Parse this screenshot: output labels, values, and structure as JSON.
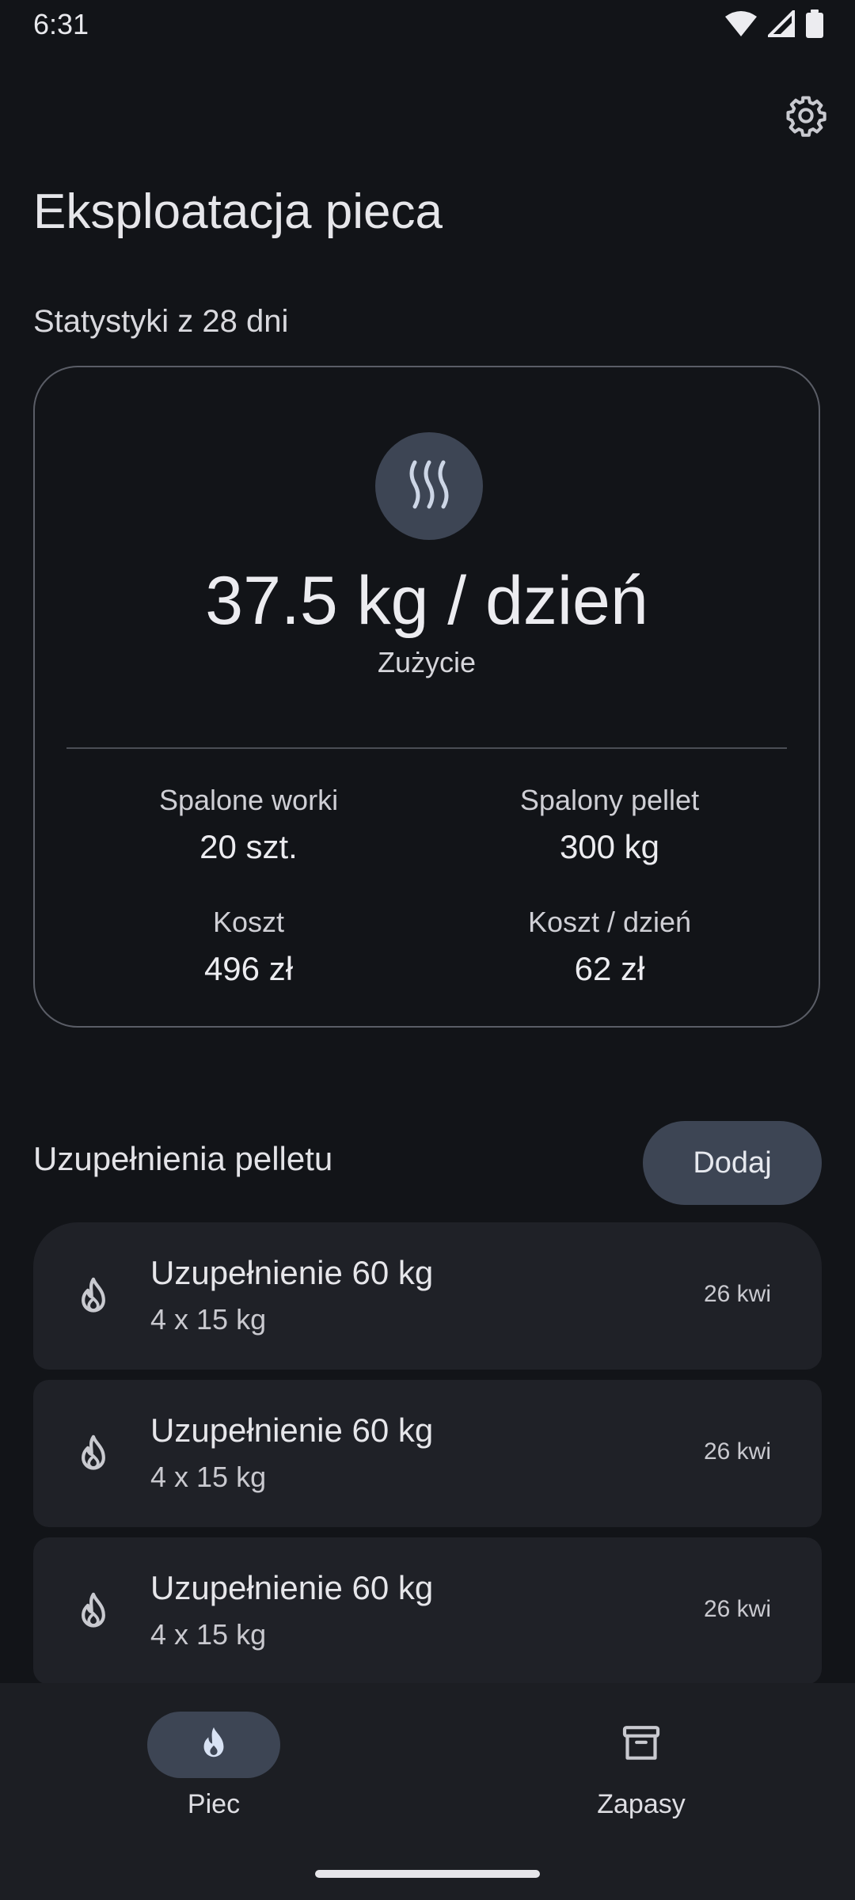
{
  "status_bar": {
    "time": "6:31"
  },
  "page": {
    "title": "Eksploatacja pieca"
  },
  "stats": {
    "section_title": "Statystyki z 28 dni",
    "main_value": "37.5 kg / dzień",
    "main_label": "Zużycie",
    "items": [
      {
        "label": "Spalone worki",
        "value": "20 szt."
      },
      {
        "label": "Spalony pellet",
        "value": "300 kg"
      },
      {
        "label": "Koszt",
        "value": "496 zł"
      },
      {
        "label": "Koszt / dzień",
        "value": "62 zł"
      }
    ]
  },
  "refills": {
    "header": "Uzupełnienia pelletu",
    "add_label": "Dodaj",
    "items": [
      {
        "title": "Uzupełnienie 60 kg",
        "subtitle": "4 x 15 kg",
        "date": "26 kwi"
      },
      {
        "title": "Uzupełnienie 60 kg",
        "subtitle": "4 x 15 kg",
        "date": "26 kwi"
      },
      {
        "title": "Uzupełnienie 60 kg",
        "subtitle": "4 x 15 kg",
        "date": "26 kwi"
      }
    ]
  },
  "nav": {
    "items": [
      {
        "label": "Piec",
        "icon": "flame-icon",
        "active": true
      },
      {
        "label": "Zapasy",
        "icon": "archive-icon",
        "active": false
      }
    ]
  },
  "colors": {
    "background": "#121418",
    "card_surface": "#1f2127",
    "accent_container": "#3d4554",
    "outline": "#5a5d66"
  }
}
